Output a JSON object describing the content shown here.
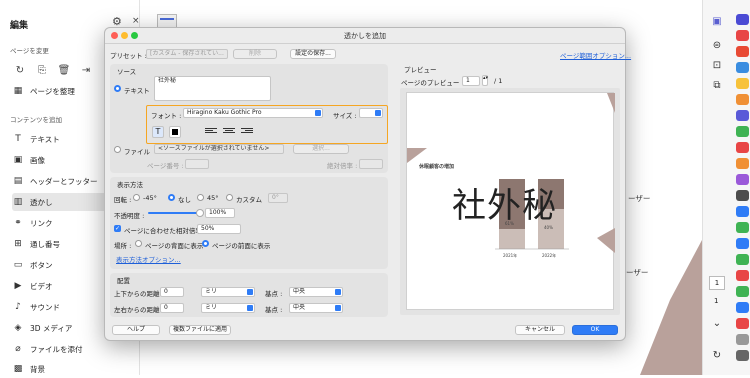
{
  "sidebar": {
    "title": "編集",
    "section_pages": "ページを変更",
    "organize_label": "ページを整理",
    "section_content": "コンテンツを追加",
    "items": [
      {
        "label": "テキスト",
        "icon": "text-plus-icon"
      },
      {
        "label": "画像",
        "icon": "image-icon"
      },
      {
        "label": "ヘッダーとフッター",
        "icon": "header-footer-icon"
      },
      {
        "label": "透かし",
        "icon": "watermark-icon"
      },
      {
        "label": "リンク",
        "icon": "link-icon"
      },
      {
        "label": "通し番号",
        "icon": "bates-icon"
      },
      {
        "label": "ボタン",
        "icon": "button-icon"
      },
      {
        "label": "ビデオ",
        "icon": "video-icon"
      },
      {
        "label": "サウンド",
        "icon": "sound-icon"
      },
      {
        "label": "3D メディア",
        "icon": "3d-icon"
      },
      {
        "label": "ファイルを添付",
        "icon": "attach-icon"
      },
      {
        "label": "背景",
        "icon": "background-icon"
      }
    ]
  },
  "document": {
    "bg_text_1": "ーザー",
    "bg_text_2": "ーザー"
  },
  "dialog": {
    "title": "透かしを追加",
    "preset_label": "プリセット :",
    "preset_value": "[カスタム - 保存されてい...",
    "delete_button": "削除",
    "save_settings_button": "設定の保存...",
    "page_range_link": "ページ範囲オプション...",
    "source_section": "ソース",
    "text_radio": "テキスト",
    "text_value": "社外秘",
    "font_label": "フォント :",
    "font_value": "Hiragino Kaku Gothic Pro",
    "size_label": "サイズ :",
    "file_radio": "ファイル",
    "file_value": "<ソースファイルが選択されていません>",
    "choose_button": "選択...",
    "page_number_label": "ページ番号 :",
    "absolute_scale_label": "絶対倍率 :",
    "appearance_section": "表示方法",
    "rotation_label": "回転 :",
    "rotation_options": [
      "-45°",
      "なし",
      "45°",
      "カスタム"
    ],
    "rotation_custom_value": "0°",
    "opacity_label": "不透明度 :",
    "opacity_value": "100%",
    "scale_check_label": "ページに合わせた相対倍率",
    "scale_value": "50%",
    "location_label": "場所 :",
    "location_back": "ページの背面に表示",
    "location_front": "ページの前面に表示",
    "appearance_options_link": "表示方法オプション...",
    "position_section": "配置",
    "vertical_label": "上下からの距離 :",
    "vertical_value": "0",
    "vertical_unit": "ミリ",
    "vertical_from_label": "基点 :",
    "vertical_from_value": "中央",
    "horizontal_label": "左右からの距離 :",
    "horizontal_value": "0",
    "horizontal_unit": "ミリ",
    "horizontal_from_label": "基点 :",
    "horizontal_from_value": "中央",
    "help_button": "ヘルプ",
    "apply_multiple_button": "複数ファイルに適用",
    "cancel_button": "キャンセル",
    "ok_button": "OK",
    "preview_section": "プレビュー",
    "preview_page_label": "ページのプレビュー",
    "preview_page_value": "1",
    "preview_page_total": "/ 1",
    "watermark_text": "社外秘",
    "preview_heading": "休眠顧客の増加",
    "preview_pct_1": "61%",
    "preview_pct_2": "40%",
    "preview_year_1": "2021年",
    "preview_year_2": "2022年"
  },
  "rail": {
    "page_number": "1",
    "page_number_2": "1"
  },
  "colors": {
    "accent": "#2f7cf6",
    "highlight_border": "#f5a623",
    "chart_brown": "#8d7770"
  }
}
